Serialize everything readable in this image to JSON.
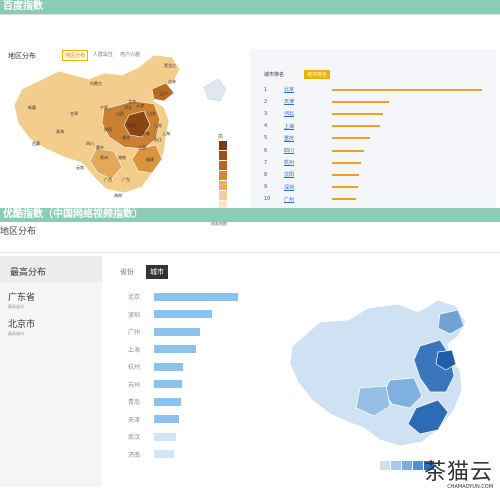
{
  "header1": "百度指数",
  "header2": "优酷指数（中国网络视频指数）",
  "baidu": {
    "section_title": "地区分布",
    "region_tabs": [
      "地区分布",
      "人群属性",
      "用户兴趣"
    ],
    "rank_header": "城市排名",
    "rank_tab": "城市排名",
    "ranks": [
      {
        "num": "1",
        "city": "北京",
        "value": 1.0
      },
      {
        "num": "2",
        "city": "天津",
        "value": 0.38
      },
      {
        "num": "3",
        "city": "河北",
        "value": 0.34
      },
      {
        "num": "4",
        "city": "上海",
        "value": 0.32
      },
      {
        "num": "5",
        "city": "重庆",
        "value": 0.25
      },
      {
        "num": "6",
        "city": "四川",
        "value": 0.21
      },
      {
        "num": "7",
        "city": "杭州",
        "value": 0.19
      },
      {
        "num": "8",
        "city": "沈阳",
        "value": 0.18
      },
      {
        "num": "9",
        "city": "深圳",
        "value": 0.17
      },
      {
        "num": "10",
        "city": "广州",
        "value": 0.16
      }
    ],
    "legend_high": "高",
    "legend_low": "低",
    "legend_caption": "搜索指数",
    "legend_colors": [
      "#7a3d10",
      "#9a5018",
      "#b8661c",
      "#d8892e",
      "#eaae5e",
      "#f4cf93",
      "#f9e6c2"
    ],
    "map_labels": [
      "新疆",
      "西藏",
      "青海",
      "甘肃",
      "内蒙古",
      "四川",
      "云南",
      "广西",
      "广东",
      "湖南",
      "湖北",
      "河南",
      "山东",
      "江苏",
      "浙江",
      "福建",
      "江西",
      "安徽",
      "山西",
      "陕西",
      "贵州",
      "重庆",
      "宁夏",
      "北京",
      "天津",
      "河北",
      "辽宁",
      "吉林",
      "黑龙江",
      "上海",
      "海南"
    ]
  },
  "youku": {
    "title": "地区分布",
    "side_header": "最高分布",
    "top_items": [
      {
        "name": "广东省",
        "sub": "最高省份"
      },
      {
        "name": "北京市",
        "sub": "最高城市"
      }
    ],
    "seg_province": "省份",
    "seg_city": "城市",
    "cities": [
      {
        "name": "北京",
        "value": 1.0
      },
      {
        "name": "深圳",
        "value": 0.69
      },
      {
        "name": "广州",
        "value": 0.55
      },
      {
        "name": "上海",
        "value": 0.5
      },
      {
        "name": "杭州",
        "value": 0.35
      },
      {
        "name": "苏州",
        "value": 0.33
      },
      {
        "name": "青岛",
        "value": 0.32
      },
      {
        "name": "天津",
        "value": 0.3
      },
      {
        "name": "武汉",
        "value": 0.26
      },
      {
        "name": "济南",
        "value": 0.24
      }
    ],
    "bar_colors": [
      "#8cc3ec",
      "#8cc3ec",
      "#8cc3ec",
      "#8cc3ec",
      "#8cc3ec",
      "#8cc3ec",
      "#8cc3ec",
      "#8cc3ec",
      "#cfe6f7",
      "#cfe6f7"
    ],
    "scale_colors": [
      "#cfe0f0",
      "#a9c9e6",
      "#7eaedb",
      "#5590cc",
      "#2f6cb3"
    ]
  },
  "watermark": {
    "cn": "茶猫云",
    "en": "CHAMAOYUN.COM"
  }
}
